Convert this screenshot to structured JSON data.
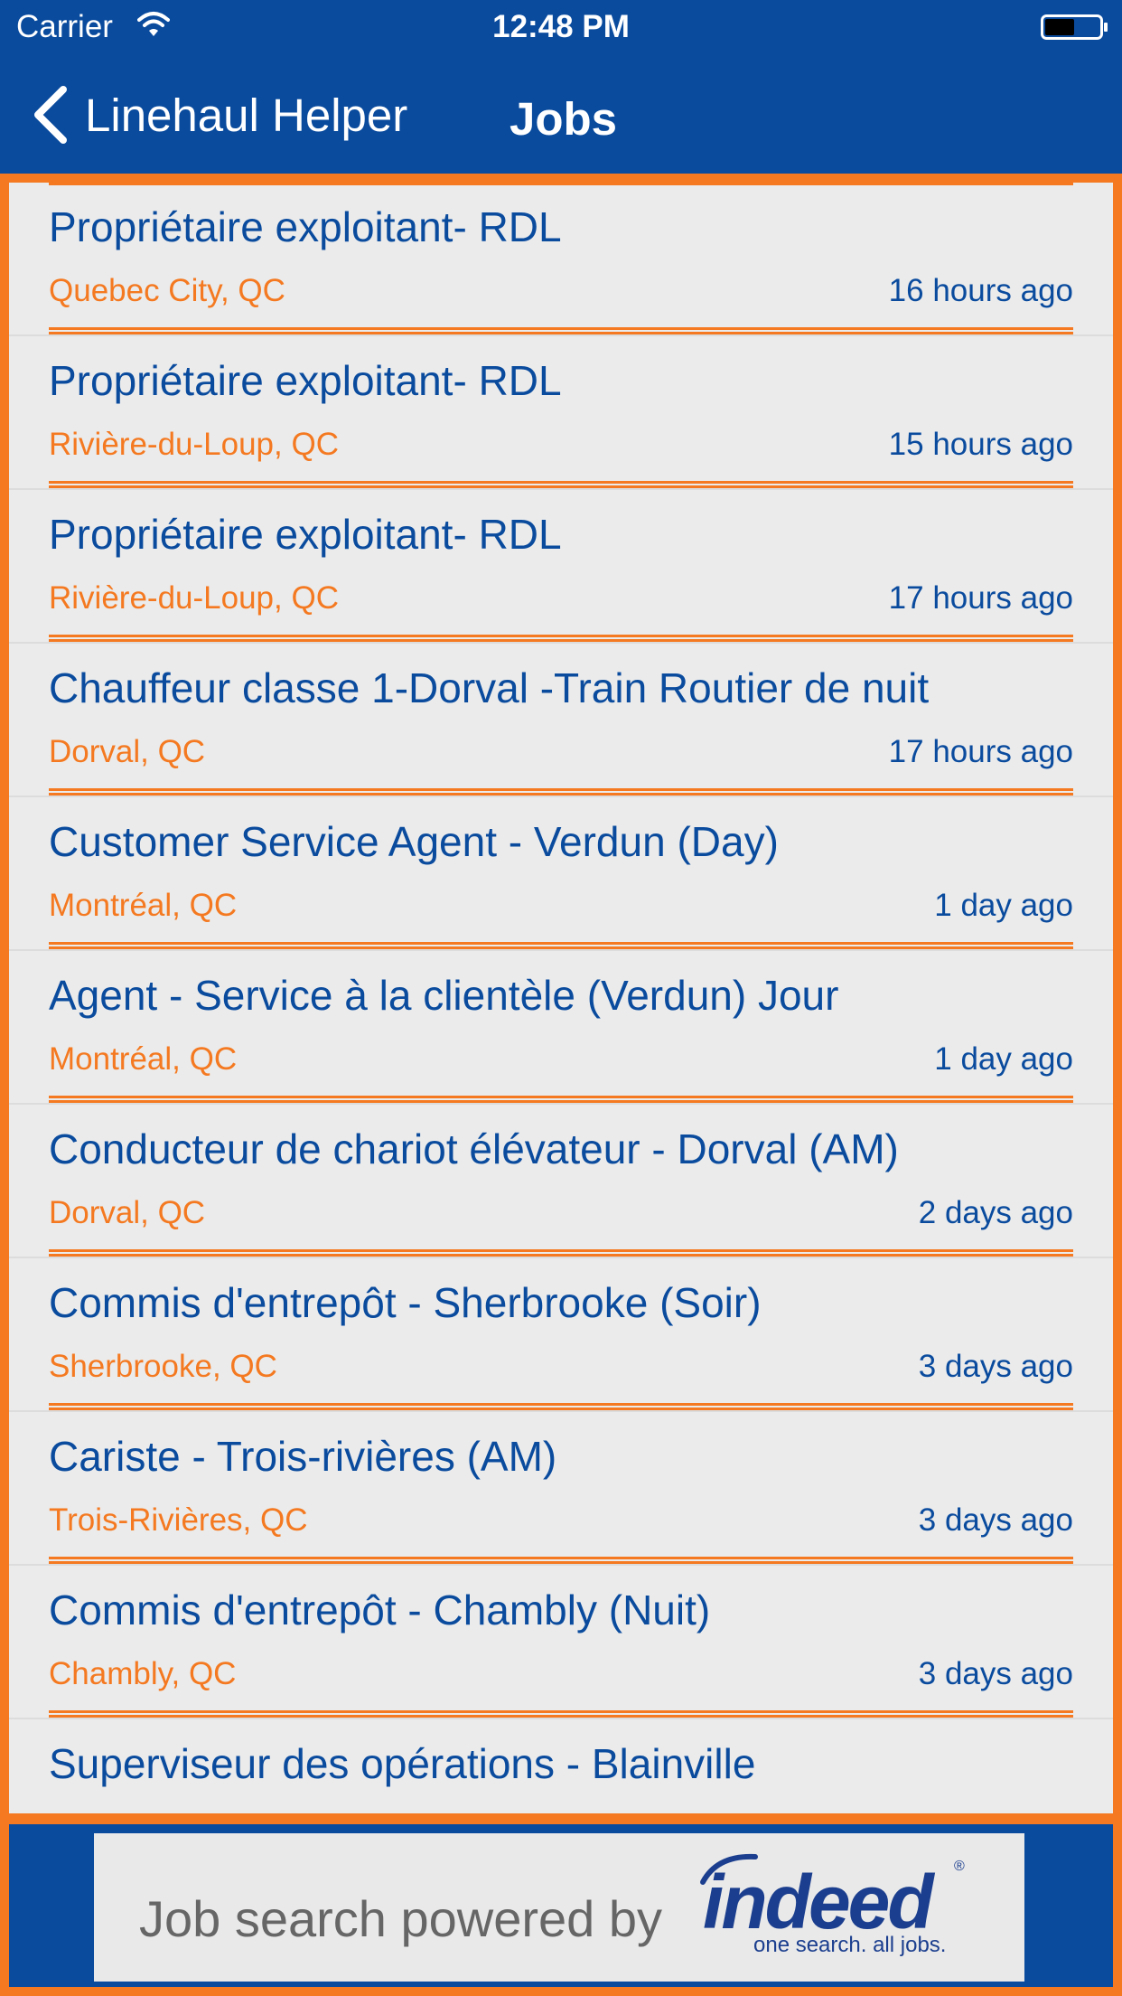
{
  "status_bar": {
    "carrier": "Carrier",
    "time": "12:48 PM"
  },
  "nav": {
    "back_label": "Linehaul Helper",
    "title": "Jobs"
  },
  "jobs": [
    {
      "title": "Propriétaire exploitant- RDL",
      "location": "Quebec City, QC",
      "age": "16 hours ago"
    },
    {
      "title": "Propriétaire exploitant- RDL",
      "location": "Rivière-du-Loup, QC",
      "age": "15 hours ago"
    },
    {
      "title": "Propriétaire exploitant- RDL",
      "location": "Rivière-du-Loup, QC",
      "age": "17 hours ago"
    },
    {
      "title": "Chauffeur classe 1-Dorval -Train Routier de nuit",
      "location": "Dorval, QC",
      "age": "17 hours ago"
    },
    {
      "title": "Customer Service Agent - Verdun (Day)",
      "location": "Montréal, QC",
      "age": "1 day ago"
    },
    {
      "title": "Agent - Service à la clientèle (Verdun) Jour",
      "location": "Montréal, QC",
      "age": "1 day ago"
    },
    {
      "title": "Conducteur de chariot élévateur - Dorval (AM)",
      "location": "Dorval, QC",
      "age": "2 days ago"
    },
    {
      "title": "Commis d'entrepôt - Sherbrooke (Soir)",
      "location": "Sherbrooke, QC",
      "age": "3 days ago"
    },
    {
      "title": "Cariste - Trois-rivières (AM)",
      "location": "Trois-Rivières, QC",
      "age": "3 days ago"
    },
    {
      "title": "Commis d'entrepôt - Chambly (Nuit)",
      "location": "Chambly, QC",
      "age": "3 days ago"
    },
    {
      "title": "Superviseur des opérations - Blainville",
      "location": "",
      "age": ""
    }
  ],
  "footer": {
    "powered_text": "Job search powered by",
    "logo_word": "indeed",
    "logo_tagline": "one search. all jobs.",
    "logo_reg": "®"
  },
  "colors": {
    "primary_blue": "#0A4B9E",
    "accent_orange": "#F47920",
    "list_bg": "#EBEBEB"
  },
  "icons": [
    "wifi-icon",
    "battery-icon",
    "chevron-left-icon"
  ]
}
